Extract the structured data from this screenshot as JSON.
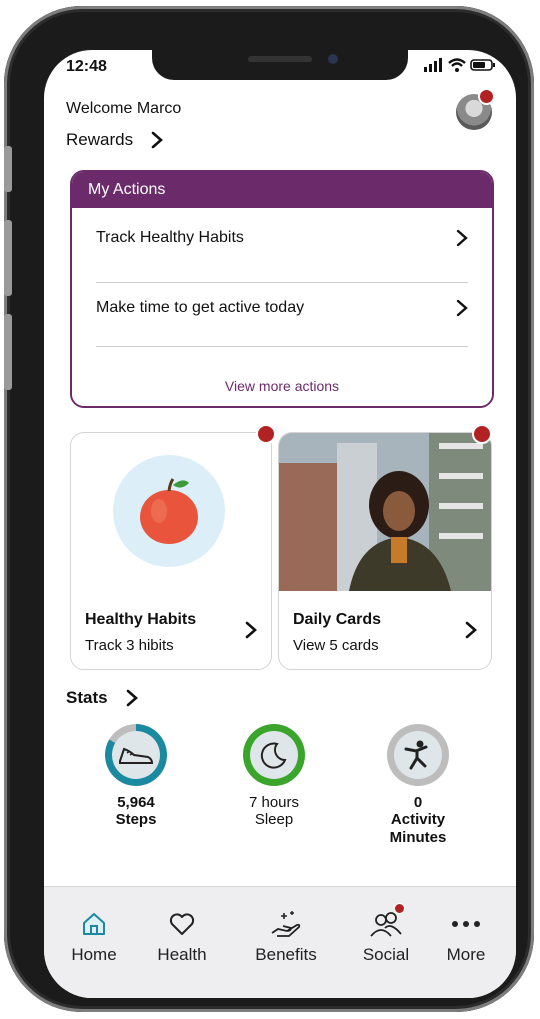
{
  "status_bar": {
    "time": "12:48"
  },
  "header": {
    "welcome": "Welcome Marco",
    "rewards_label": "Rewards"
  },
  "my_actions": {
    "title": "My Actions",
    "items": [
      {
        "label": "Track Healthy Habits"
      },
      {
        "label": "Make time to get active today"
      }
    ],
    "view_more": "View more actions"
  },
  "cards": [
    {
      "title": "Healthy Habits",
      "subtitle": "Track 3 hibits",
      "image_icon": "apple-icon"
    },
    {
      "title": "Daily Cards",
      "subtitle": "View 5 cards",
      "image_icon": "woman-photo"
    }
  ],
  "stats": {
    "label": "Stats",
    "items": [
      {
        "value": "5,964",
        "label": "Steps",
        "icon": "sneaker-icon",
        "ring_color": "#1b8aa0"
      },
      {
        "value": "7 hours",
        "label": "Sleep",
        "icon": "moon-icon",
        "ring_color": "#3aa52a"
      },
      {
        "value": "0",
        "label": "Activity Minutes",
        "icon": "running-figure-icon",
        "ring_color": "#bdbdbd"
      }
    ]
  },
  "tabbar": [
    {
      "label": "Home",
      "icon": "home-icon",
      "active": true
    },
    {
      "label": "Health",
      "icon": "heart-icon"
    },
    {
      "label": "Benefits",
      "icon": "hand-sparkle-icon"
    },
    {
      "label": "Social",
      "icon": "people-icon",
      "badge": true
    },
    {
      "label": "More",
      "icon": "more-dots-icon"
    }
  ],
  "colors": {
    "primary": "#6b2b6a",
    "badge": "#b22222",
    "active_tab": "#1b8aa0"
  }
}
